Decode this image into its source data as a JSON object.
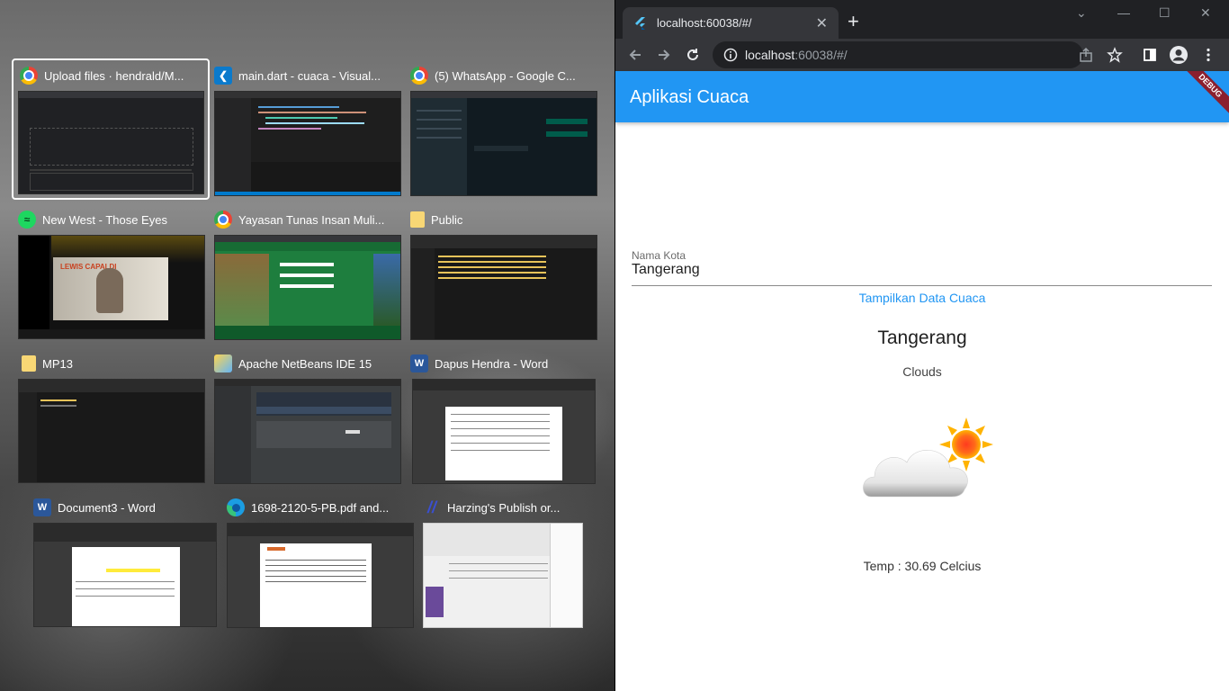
{
  "snap_windows": [
    {
      "title": "Upload files · hendrald/M...",
      "icon": "chrome-icon",
      "selected": true
    },
    {
      "title": "main.dart - cuaca - Visual...",
      "icon": "vscode-icon",
      "selected": false
    },
    {
      "title": "(5) WhatsApp - Google C...",
      "icon": "chrome-icon",
      "selected": false
    },
    {
      "title": "New West - Those Eyes",
      "icon": "spotify-icon",
      "selected": false
    },
    {
      "title": "Yayasan Tunas Insan Muli...",
      "icon": "chrome-icon",
      "selected": false
    },
    {
      "title": "Public",
      "icon": "folder-icon",
      "selected": false
    },
    {
      "title": "MP13",
      "icon": "folder-icon",
      "selected": false
    },
    {
      "title": "Apache NetBeans IDE 15",
      "icon": "netbeans-icon",
      "selected": false
    },
    {
      "title": "Dapus Hendra - Word",
      "icon": "word-icon",
      "selected": false
    },
    {
      "title": "Document3 - Word",
      "icon": "word-icon",
      "selected": false
    },
    {
      "title": "1698-2120-5-PB.pdf and...",
      "icon": "edge-icon",
      "selected": false
    },
    {
      "title": "Harzing's Publish or...",
      "icon": "harzing-icon",
      "selected": false
    }
  ],
  "browser": {
    "tab_title": "localhost:60038/#/",
    "url_host": "localhost",
    "url_path": ":60038/#/"
  },
  "app": {
    "title": "Aplikasi Cuaca",
    "debug_label": "DEBUG",
    "field_label": "Nama Kota",
    "field_value": "Tangerang",
    "button_label": "Tampilkan Data Cuaca",
    "city": "Tangerang",
    "description": "Clouds",
    "temp_text": "Temp : 30.69 Celcius",
    "weather_icon": "partly-cloudy-icon"
  },
  "colors": {
    "appbar": "#2196f3",
    "button_text": "#2196f3",
    "browser_dark": "#202124",
    "debug_ribbon": "#8b1f2e"
  }
}
